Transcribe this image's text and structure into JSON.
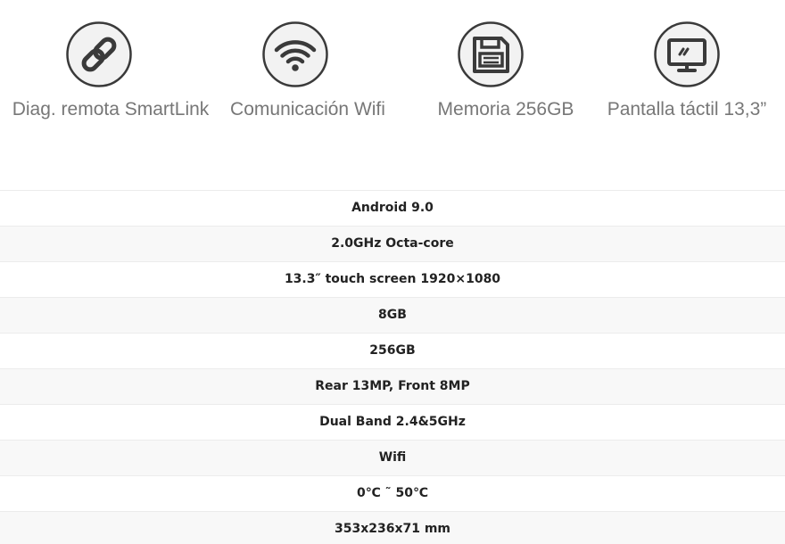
{
  "features": [
    {
      "icon": "link-icon",
      "label": "Diag. remota SmartLink"
    },
    {
      "icon": "wifi-icon",
      "label": "Comunicación Wifi"
    },
    {
      "icon": "save-disk-icon",
      "label": "Memoria 256GB"
    },
    {
      "icon": "monitor-icon",
      "label": "Pantalla táctil 13,3”"
    }
  ],
  "specs": [
    "Android 9.0",
    "2.0GHz Octa-core",
    "13.3″ touch screen 1920×1080",
    "8GB",
    "256GB",
    "Rear 13MP, Front 8MP",
    "Dual Band 2.4&5GHz",
    "Wifi",
    "0℃ ˜ 50℃",
    "353x236x71 mm"
  ],
  "colors": {
    "icon_stroke": "#3a3a3a",
    "icon_fill": "#f2f2f2",
    "label_text": "#777777",
    "row_alt": "#f8f8f8"
  }
}
